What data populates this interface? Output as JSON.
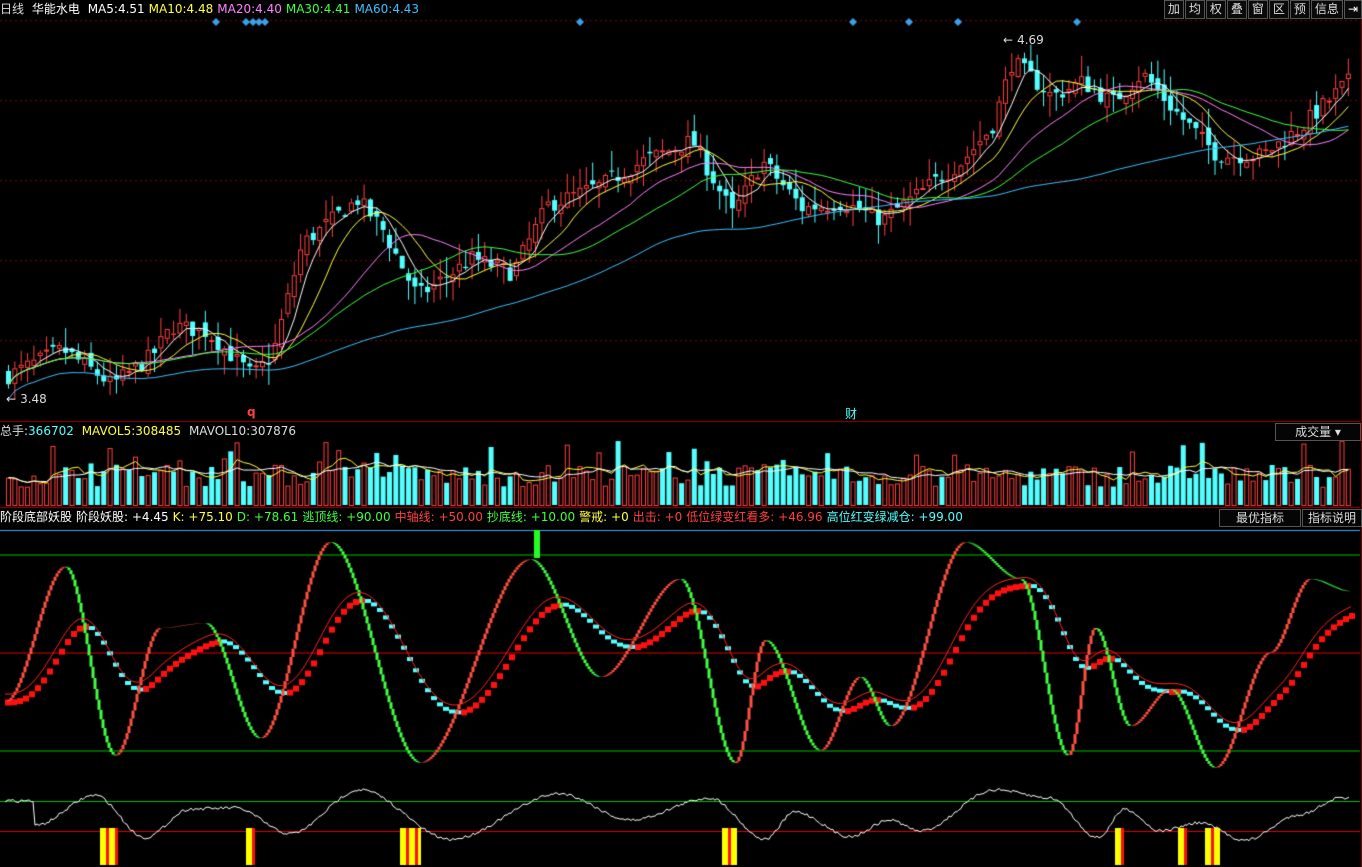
{
  "colors": {
    "up": "#ff4040",
    "down": "#54ffff",
    "ma5": "#ffffff",
    "ma10": "#ffff40",
    "ma20": "#ff80ff",
    "ma30": "#40ff40",
    "ma60": "#40c0ff",
    "grid": "#7a0000"
  },
  "header": {
    "period": "日线",
    "name": "华能水电",
    "ma": [
      {
        "label": "MA5:",
        "value": "4.51",
        "color": "#ffffff"
      },
      {
        "label": "MA10:",
        "value": "4.48",
        "color": "#ffff40"
      },
      {
        "label": "MA20:",
        "value": "4.40",
        "color": "#ff80ff"
      },
      {
        "label": "MA30:",
        "value": "4.41",
        "color": "#40ff40"
      },
      {
        "label": "MA60:",
        "value": "4.43",
        "color": "#40c0ff"
      }
    ]
  },
  "toolbar": [
    "加",
    "均",
    "权",
    "叠",
    "窗",
    "区",
    "预",
    "信息"
  ],
  "exit_icon": "exit-icon",
  "price": {
    "high_label": "4.69",
    "low_label": "3.48",
    "marker_q": "q",
    "marker_cai": "财"
  },
  "volume": {
    "total_label": "总手:",
    "total_value": "366702",
    "mavol5_label": "MAVOL5:",
    "mavol5_value": "308485",
    "mavol10_label": "MAVOL10:",
    "mavol10_value": "307876",
    "selector": "成交量"
  },
  "indicator": {
    "items": [
      {
        "text": "阶段底部妖股",
        "color": "#ffffff"
      },
      {
        "text": "阶段妖股: +4.45",
        "color": "#ffffff"
      },
      {
        "text": "K: +75.10",
        "color": "#ffff40"
      },
      {
        "text": "D: +78.61",
        "color": "#40ff40"
      },
      {
        "text": "逃顶线: +90.00",
        "color": "#40ff40"
      },
      {
        "text": "中轴线: +50.00",
        "color": "#ff4040"
      },
      {
        "text": "抄底线: +10.00",
        "color": "#40ff40"
      },
      {
        "text": "警戒: +0",
        "color": "#ffff40"
      },
      {
        "text": "出击: +0",
        "color": "#ff4040"
      },
      {
        "text": "低位绿变红看多: +46.96",
        "color": "#ff4040"
      },
      {
        "text": "高位红变绿减仓: +99.00",
        "color": "#54ffff"
      }
    ],
    "best_button": "最优指标",
    "help_button": "指标说明"
  }
}
